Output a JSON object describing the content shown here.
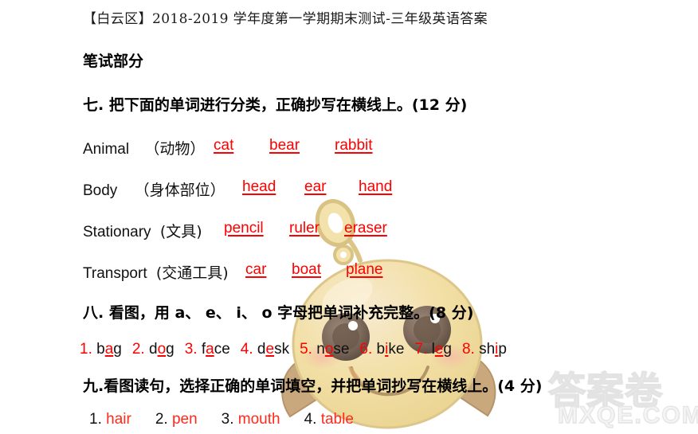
{
  "document": {
    "title": "【白云区】2018-2019 学年度第一学期期末测试-三年级英语答案",
    "part_title": "笔试部分"
  },
  "sections": {
    "q7": {
      "heading": "七. 把下面的单词进行分类，正确抄写在横线上。(12 分)",
      "rows": [
        {
          "label": "Animal",
          "cn": "（动物）",
          "answers": [
            "cat",
            "bear",
            "rabbit"
          ]
        },
        {
          "label": "Body",
          "cn": "（身体部位）",
          "answers": [
            "head",
            "ear",
            "hand"
          ]
        },
        {
          "label": "Stationary",
          "cn": "(文具)",
          "answers": [
            "pencil",
            "ruler",
            "eraser"
          ]
        },
        {
          "label": "Transport",
          "cn": "(交通工具)",
          "answers": [
            "car",
            "boat",
            "plane"
          ]
        }
      ]
    },
    "q8": {
      "heading": "八. 看图，用 a、 e、 i、 o 字母把单词补充完整。(8 分)",
      "items": [
        {
          "num": "1.",
          "pre": "b",
          "vowel": "a",
          "post": "g"
        },
        {
          "num": "2.",
          "pre": "d",
          "vowel": "o",
          "post": "g"
        },
        {
          "num": "3.",
          "pre": "f",
          "vowel": "a",
          "post": "ce"
        },
        {
          "num": "4.",
          "pre": "d",
          "vowel": "e",
          "post": "sk"
        },
        {
          "num": "5.",
          "pre": "n",
          "vowel": "o",
          "post": "se"
        },
        {
          "num": "6.",
          "pre": "b",
          "vowel": "i",
          "post": "ke"
        },
        {
          "num": "7.",
          "pre": "l",
          "vowel": "e",
          "post": "g"
        },
        {
          "num": "8.",
          "pre": "sh",
          "vowel": "i",
          "post": "p"
        }
      ]
    },
    "q9": {
      "heading": "九.看图读句，选择正确的单词填空，并把单词抄写在横线上。(4 分)",
      "items": [
        {
          "num": "1.",
          "word": "hair"
        },
        {
          "num": "2.",
          "word": "pen"
        },
        {
          "num": "3.",
          "word": "mouth"
        },
        {
          "num": "4.",
          "word": "table"
        }
      ]
    }
  },
  "watermark": {
    "chinese": "答案卷",
    "site": "MXQE.COM"
  },
  "colors": {
    "answer_red": "#ff0000",
    "word_red": "#ff2a1a",
    "text_black": "#111111",
    "chick_body": "#f2dc9a",
    "chick_outline": "#d8c27e",
    "watermark_gray": "#e3e3e3"
  }
}
